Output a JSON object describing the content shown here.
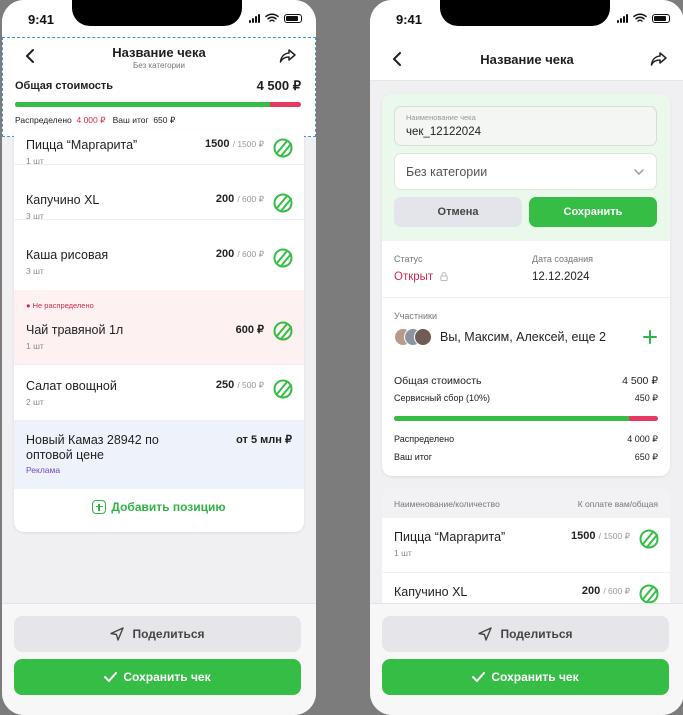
{
  "status_bar": {
    "time": "9:41"
  },
  "left": {
    "header": {
      "title": "Название чека",
      "subtitle": "Без категории",
      "total_label": "Общая стоимость",
      "total_value": "4 500 ₽",
      "distributed_label": "Распределено",
      "distributed_value": "4 000 ₽",
      "your_total_label": "Ваш итог",
      "your_total_value": "650 ₽",
      "progress_distributed": 0.89
    },
    "items": [
      {
        "name": "Пицца “Маргарита”",
        "qty": "1 шт",
        "price": "1500",
        "total": "/ 1500 ₽"
      },
      {
        "name": "Капучино XL",
        "qty": "3 шт",
        "price": "200",
        "total": "/ 600 ₽"
      },
      {
        "name": "Каша рисовая",
        "qty": "3 шт",
        "price": "200",
        "total": "/ 600 ₽"
      },
      {
        "tag": "Не распределено",
        "name": "Чай травяной 1л",
        "qty": "1 шт",
        "price": "600 ₽"
      },
      {
        "name": "Салат овощной",
        "qty": "2 шт",
        "price": "250",
        "total": "/ 500 ₽"
      }
    ],
    "ad": {
      "title": "Новый Камаз 28942 по оптовой цене",
      "price": "от 5 млн ₽",
      "label": "Реклама"
    },
    "add_position": "Добавить позицию",
    "share_button": "Поделиться",
    "save_button": "Сохранить чек"
  },
  "right": {
    "header": {
      "title": "Название чека"
    },
    "name_field": {
      "label": "Наименование чека",
      "value": "чек_12122024"
    },
    "category_select": {
      "value": "Без категории"
    },
    "cancel_button": "Отмена",
    "apply_button": "Сохранить",
    "status_label": "Статус",
    "status_value": "Открыт",
    "created_label": "Дата создания",
    "created_value": "12.12.2024",
    "participants_label": "Участники",
    "participants_value": "Вы, Максим, Алексей, еще 2",
    "total_label": "Общая стоимость",
    "total_value": "4 500 ₽",
    "service_label": "Сервисный сбор (10%)",
    "service_value": "450 ₽",
    "distributed_label": "Распределено",
    "distributed_value": "4 000 ₽",
    "your_total_label": "Ваш итог",
    "your_total_value": "650 ₽",
    "progress_distributed": 0.89,
    "items_header_left": "Наименование/количество",
    "items_header_right": "К оплате вам/общая",
    "items": [
      {
        "name": "Пицца “Маргарита”",
        "qty": "1 шт",
        "price": "1500",
        "total": "/ 1500 ₽"
      },
      {
        "name": "Капучино XL",
        "qty": "",
        "price": "200",
        "total": "/ 600 ₽"
      }
    ],
    "share_button": "Поделиться",
    "save_button": "Сохранить чек"
  },
  "colors": {
    "accent": "#36bd45",
    "danger": "#e0294e",
    "ad_label": "#7a44c8"
  }
}
